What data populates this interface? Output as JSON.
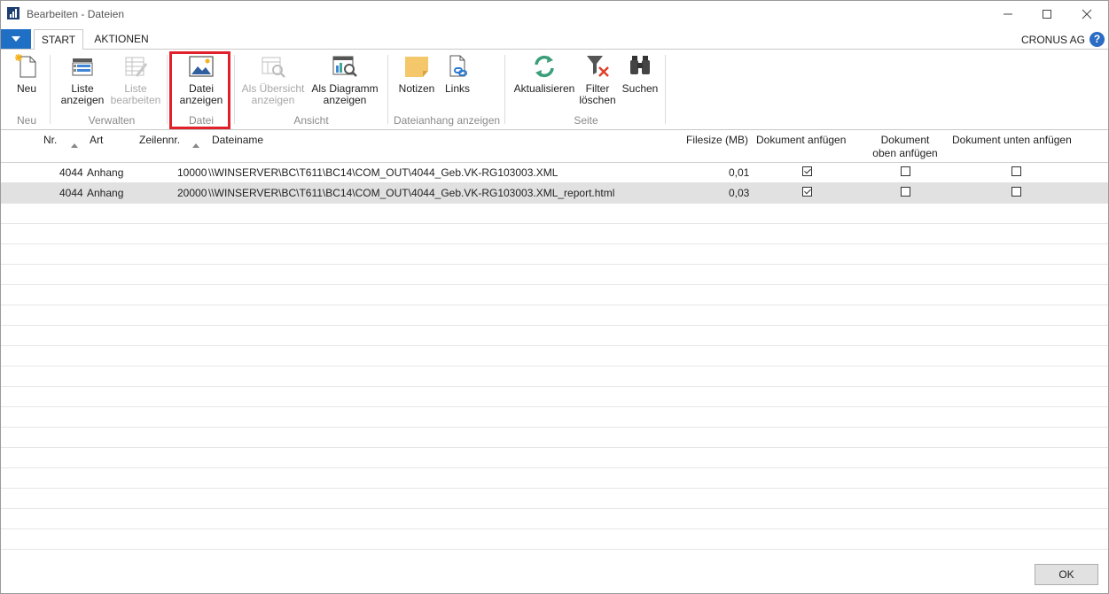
{
  "window": {
    "title": "Bearbeiten - Dateien"
  },
  "tabs": {
    "start": "START",
    "actions": "AKTIONEN"
  },
  "company": "CRONUS AG",
  "help": "?",
  "ribbon": {
    "neu": "Neu",
    "liste_anzeigen_1": "Liste",
    "liste_anzeigen_2": "anzeigen",
    "liste_bearbeiten_1": "Liste",
    "liste_bearbeiten_2": "bearbeiten",
    "datei_anzeigen_1": "Datei",
    "datei_anzeigen_2": "anzeigen",
    "als_uebersicht_1": "Als Übersicht",
    "als_uebersicht_2": "anzeigen",
    "als_diagramm_1": "Als Diagramm",
    "als_diagramm_2": "anzeigen",
    "notizen": "Notizen",
    "links": "Links",
    "aktualisieren": "Aktualisieren",
    "filter_loeschen_1": "Filter",
    "filter_loeschen_2": "löschen",
    "suchen": "Suchen",
    "groups": {
      "neu": "Neu",
      "verwalten": "Verwalten",
      "datei": "Datei",
      "ansicht": "Ansicht",
      "dateianhang": "Dateianhang anzeigen",
      "seite": "Seite"
    }
  },
  "columns": {
    "nr": "Nr.",
    "art": "Art",
    "zeilennr": "Zeilennr.",
    "dateiname": "Dateiname",
    "filesize": "Filesize (MB)",
    "dok_anfuegen": "Dokument anfügen",
    "dok_oben_1": "Dokument",
    "dok_oben_2": "oben anfügen",
    "dok_unten": "Dokument unten anfügen"
  },
  "rows": [
    {
      "nr": "4044",
      "art": "Anhang",
      "zeilennr": "10000",
      "dateiname": "\\\\WINSERVER\\BC\\T611\\BC14\\COM_OUT\\4044_Geb.VK-RG103003.XML",
      "filesize": "0,01",
      "dok_anfuegen": true,
      "dok_oben": false,
      "dok_unten": false
    },
    {
      "nr": "4044",
      "art": "Anhang",
      "zeilennr": "20000",
      "dateiname": "\\\\WINSERVER\\BC\\T611\\BC14\\COM_OUT\\4044_Geb.VK-RG103003.XML_report.html",
      "filesize": "0,03",
      "dok_anfuegen": true,
      "dok_oben": false,
      "dok_unten": false
    }
  ],
  "footer": {
    "ok": "OK"
  },
  "colors": {
    "accent": "#1f6fc5",
    "highlight": "#e0202a",
    "selected_row": "#e1e1e1"
  }
}
